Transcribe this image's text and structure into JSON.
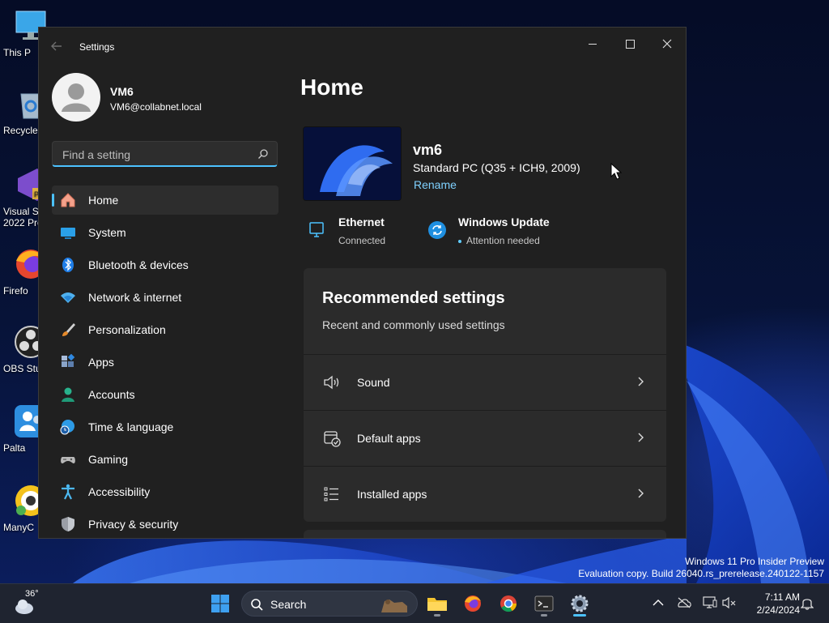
{
  "desktop": {
    "icons": [
      {
        "label": "This P"
      },
      {
        "label": "Recycle"
      },
      {
        "label_line1": "Visual St",
        "label_line2": "2022 Pre"
      },
      {
        "label": "Firefo"
      },
      {
        "label": "OBS Stu"
      },
      {
        "label": "Palta"
      },
      {
        "label": "ManyC"
      }
    ],
    "watermark": {
      "line1": "Windows 11 Pro Insider Preview",
      "line2": "Evaluation copy. Build 26040.rs_prerelease.240122-1157"
    }
  },
  "window": {
    "title": "Settings",
    "controls": {
      "minimize": "minimize-icon",
      "maximize": "maximize-icon",
      "close": "close-icon"
    }
  },
  "user": {
    "name": "VM6",
    "email": "VM6@collabnet.local"
  },
  "search": {
    "placeholder": "Find a setting"
  },
  "nav": {
    "items": [
      {
        "label": "Home",
        "icon": "home-icon",
        "active": true
      },
      {
        "label": "System",
        "icon": "system-icon"
      },
      {
        "label": "Bluetooth & devices",
        "icon": "bluetooth-icon"
      },
      {
        "label": "Network & internet",
        "icon": "wifi-icon"
      },
      {
        "label": "Personalization",
        "icon": "brush-icon"
      },
      {
        "label": "Apps",
        "icon": "apps-icon"
      },
      {
        "label": "Accounts",
        "icon": "accounts-icon"
      },
      {
        "label": "Time & language",
        "icon": "globe-clock-icon"
      },
      {
        "label": "Gaming",
        "icon": "gamepad-icon"
      },
      {
        "label": "Accessibility",
        "icon": "accessibility-icon"
      },
      {
        "label": "Privacy & security",
        "icon": "shield-icon"
      }
    ]
  },
  "main": {
    "title": "Home",
    "device": {
      "name": "vm6",
      "model": "Standard PC (Q35 + ICH9, 2009)",
      "rename": "Rename"
    },
    "status": {
      "network": {
        "title": "Ethernet",
        "sub": "Connected"
      },
      "update": {
        "title": "Windows Update",
        "sub": "Attention needed"
      }
    },
    "recommended": {
      "title": "Recommended settings",
      "subtitle": "Recent and commonly used settings",
      "rows": [
        {
          "label": "Sound",
          "icon": "speaker-icon"
        },
        {
          "label": "Default apps",
          "icon": "default-apps-icon"
        },
        {
          "label": "Installed apps",
          "icon": "list-icon"
        }
      ]
    }
  },
  "taskbar": {
    "weather_temp": "36°",
    "search_label": "Search",
    "clock_time": "7:11 AM",
    "clock_date": "2/24/2024"
  },
  "colors": {
    "accent": "#4cc2ff",
    "link": "#7fd1ff",
    "window_bg": "#202020",
    "card_bg": "#2b2b2b"
  }
}
